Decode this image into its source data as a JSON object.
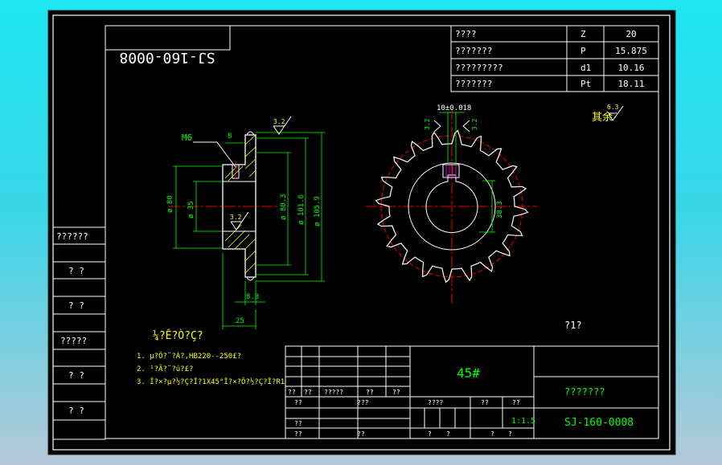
{
  "drawing": {
    "number": "SJ-160-0008",
    "number_mirrored": "SJ-160-0008",
    "material": "45#",
    "name": "???????",
    "scale": "1:1.5",
    "roughness_note": "?1?",
    "other_roughness": {
      "label": "其余",
      "value": "6.3"
    }
  },
  "spec_table": [
    {
      "label": "????",
      "symbol": "Z",
      "value": "20"
    },
    {
      "label": "???????",
      "symbol": "P",
      "value": "15.875"
    },
    {
      "label": "?????????",
      "symbol": "d1",
      "value": "10.16"
    },
    {
      "label": "???????",
      "symbol": "Pt",
      "value": "18.11"
    }
  ],
  "left_column": [
    "??????",
    "? ?",
    "? ?",
    "?????",
    "? ?",
    "? ?"
  ],
  "notes": {
    "title": "¼?Ê?Ò?Ç?",
    "lines": [
      "1. µ?Ö?¨?À?,HB220--250£?",
      "2. ¹?Ã?¨?ú?£?",
      "3. Î?×?µ?½?Ç?Î?1X45°Î?×?Ö?½?Ç?Î?R1"
    ]
  },
  "side_view": {
    "thread": "M6",
    "dims": {
      "top": "8",
      "roughness_top": "3.2",
      "roughness_mid": "3.2",
      "d1": "ø 80",
      "d2": "ø 35",
      "d3": "ø 80.3",
      "d4": "ø 101.6",
      "d5": "ø 105.9",
      "bottom_small": "8.8",
      "bottom": "25"
    }
  },
  "front_view": {
    "keyway": "10±0.018",
    "roughness_left": "3.2",
    "roughness_right": "3.2",
    "depth": "38.3"
  },
  "title_block": {
    "row1": [
      "??",
      "??",
      "?????",
      "??",
      "??"
    ],
    "row2": [
      "??",
      "???"
    ],
    "row3": [
      "??"
    ],
    "row4": [
      "??",
      "??"
    ],
    "mid": [
      "????",
      "??",
      "??"
    ],
    "bottom": [
      "?",
      "?",
      "?",
      "?"
    ]
  }
}
